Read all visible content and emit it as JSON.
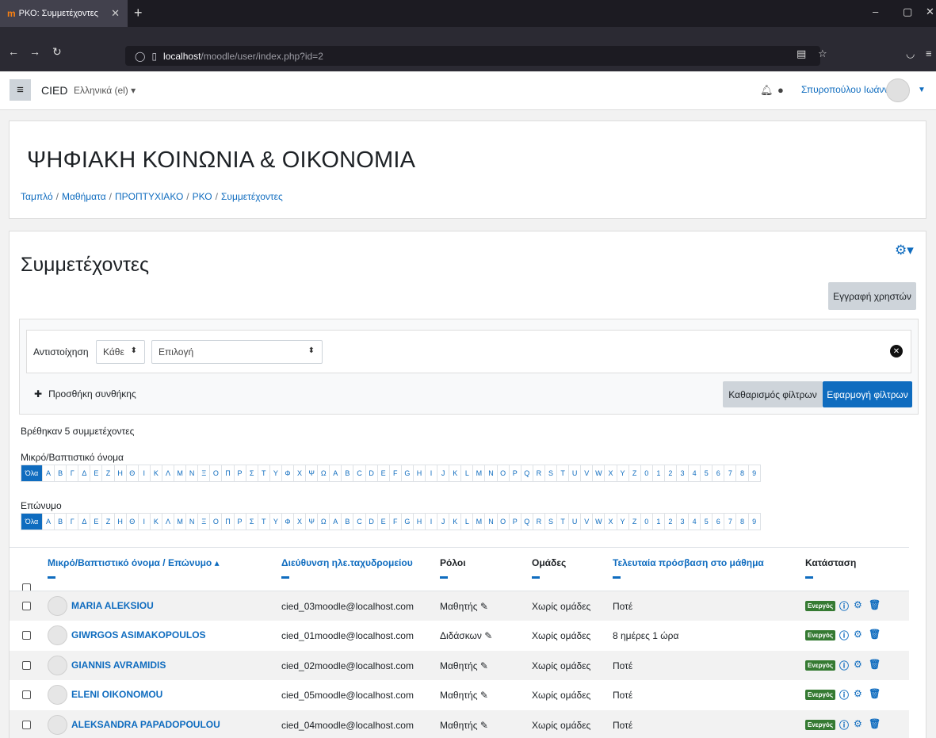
{
  "browser": {
    "tab_title": "ΡΚΟ: Συμμετέχοντες",
    "url_host": "localhost",
    "url_path": "/moodle/user/index.php?id=2"
  },
  "navbar": {
    "site_name": "CIED",
    "language": "Ελληνικά (el) ▾",
    "user_name": "Σπυροπούλου Ιωάννα"
  },
  "header": {
    "course_title": "ΨΗΦΙΑΚΗ ΚΟΙΝΩΝΙΑ & ΟΙΚΟΝΟΜΙΑ",
    "breadcrumbs": [
      "Ταμπλό",
      "Μαθήματα",
      "ΠΡΟΠΤΥΧΙΑΚΟ",
      "ΡΚΟ",
      "Συμμετέχοντες"
    ]
  },
  "main": {
    "title": "Συμμετέχοντες",
    "enrol_button": "Εγγραφή χρηστών",
    "filter": {
      "match_label": "Αντιστοίχηση",
      "match_value": "Κάθε",
      "select_value": "Επιλογή",
      "add_condition": "Προσθήκη συνθήκης",
      "clear_button": "Καθαρισμός φίλτρων",
      "apply_button": "Εφαρμογή φίλτρων"
    },
    "found_text": "Βρέθηκαν 5 συμμετέχοντες",
    "firstname_label": "Μικρό/Βαπτιστικό όνομα",
    "lastname_label": "Επώνυμο",
    "initials": [
      "Όλα",
      "Α",
      "Β",
      "Γ",
      "Δ",
      "Ε",
      "Ζ",
      "Η",
      "Θ",
      "Ι",
      "Κ",
      "Λ",
      "Μ",
      "Ν",
      "Ξ",
      "Ο",
      "Π",
      "Ρ",
      "Σ",
      "Τ",
      "Υ",
      "Φ",
      "Χ",
      "Ψ",
      "Ω",
      "A",
      "B",
      "C",
      "D",
      "E",
      "F",
      "G",
      "H",
      "I",
      "J",
      "K",
      "L",
      "M",
      "N",
      "O",
      "P",
      "Q",
      "R",
      "S",
      "T",
      "U",
      "V",
      "W",
      "X",
      "Y",
      "Z",
      "0",
      "1",
      "2",
      "3",
      "4",
      "5",
      "6",
      "7",
      "8",
      "9"
    ]
  },
  "table": {
    "headers": {
      "name": "Μικρό/Βαπτιστικό όνομα / Επώνυμο ▴",
      "email": "Διεύθυνση ηλε.ταχυδρομείου",
      "roles": "Ρόλοι",
      "groups": "Ομάδες",
      "last_access": "Τελευταία πρόσβαση στο μάθημα",
      "status": "Κατάσταση"
    },
    "rows": [
      {
        "name": "MARIA ALEKSIOU",
        "email": "cied_03moodle@localhost.com",
        "role": "Μαθητής",
        "groups": "Χωρίς ομάδες",
        "last_access": "Ποτέ",
        "status": "Ενεργός"
      },
      {
        "name": "GIWRGOS ASIMAKOPOULOS",
        "email": "cied_01moodle@localhost.com",
        "role": "Διδάσκων",
        "groups": "Χωρίς ομάδες",
        "last_access": "8 ημέρες 1 ώρα",
        "status": "Ενεργός"
      },
      {
        "name": "GIANNIS AVRAMIDIS",
        "email": "cied_02moodle@localhost.com",
        "role": "Μαθητής",
        "groups": "Χωρίς ομάδες",
        "last_access": "Ποτέ",
        "status": "Ενεργός"
      },
      {
        "name": "ELENI OIKONOMOU",
        "email": "cied_05moodle@localhost.com",
        "role": "Μαθητής",
        "groups": "Χωρίς ομάδες",
        "last_access": "Ποτέ",
        "status": "Ενεργός"
      },
      {
        "name": "ALEKSANDRA PAPADOPOULOU",
        "email": "cied_04moodle@localhost.com",
        "role": "Μαθητής",
        "groups": "Χωρίς ομάδες",
        "last_access": "Ποτέ",
        "status": "Ενεργός"
      }
    ]
  },
  "colors": {
    "link": "#0f6cbf",
    "badge_active": "#357a32"
  }
}
